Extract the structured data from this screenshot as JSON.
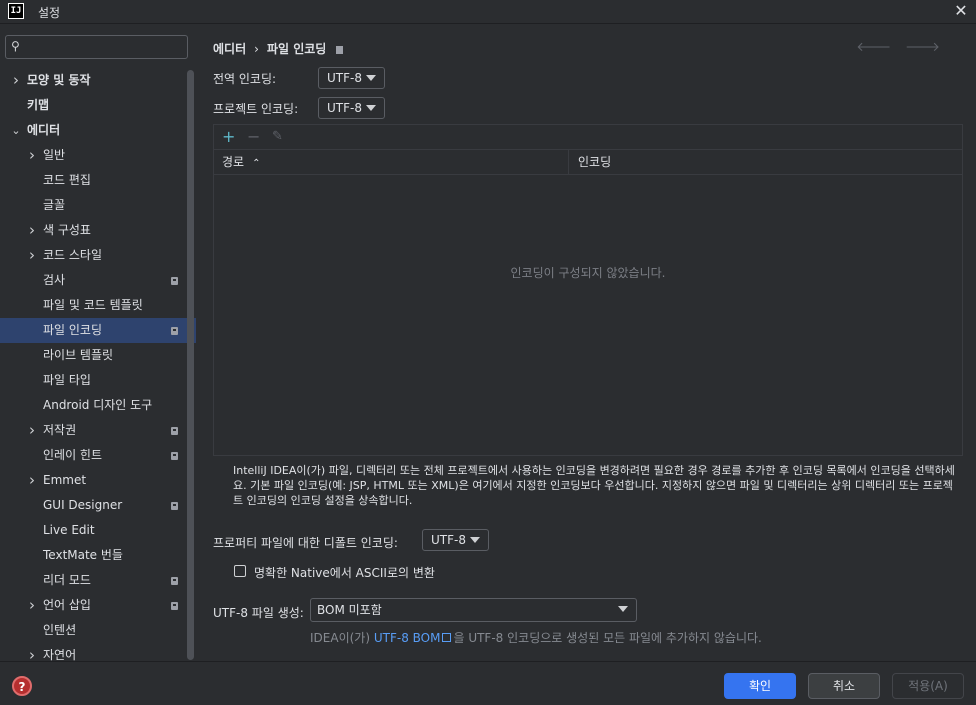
{
  "window": {
    "title": "설정",
    "logo": "IJ"
  },
  "search": {
    "placeholder": "",
    "value": ""
  },
  "sidebar": {
    "items": [
      {
        "label": "모양 및 동작",
        "level": 0,
        "expandable": true,
        "expanded": false,
        "bold": true
      },
      {
        "label": "키맵",
        "level": 0,
        "expandable": false,
        "bold": true
      },
      {
        "label": "에디터",
        "level": 0,
        "expandable": true,
        "expanded": true,
        "bold": true
      },
      {
        "label": "일반",
        "level": 1,
        "expandable": true,
        "expanded": false
      },
      {
        "label": "코드 편집",
        "level": 1
      },
      {
        "label": "글꼴",
        "level": 1
      },
      {
        "label": "색 구성표",
        "level": 1,
        "expandable": true,
        "expanded": false
      },
      {
        "label": "코드 스타일",
        "level": 1,
        "expandable": true,
        "expanded": false
      },
      {
        "label": "검사",
        "level": 1,
        "badge": true
      },
      {
        "label": "파일 및 코드 템플릿",
        "level": 1
      },
      {
        "label": "파일 인코딩",
        "level": 1,
        "badge": true,
        "selected": true
      },
      {
        "label": "라이브 템플릿",
        "level": 1
      },
      {
        "label": "파일 타입",
        "level": 1
      },
      {
        "label": "Android 디자인 도구",
        "level": 1
      },
      {
        "label": "저작권",
        "level": 1,
        "expandable": true,
        "expanded": false,
        "badge": true
      },
      {
        "label": "인레이 힌트",
        "level": 1,
        "badge": true
      },
      {
        "label": "Emmet",
        "level": 1,
        "expandable": true,
        "expanded": false
      },
      {
        "label": "GUI Designer",
        "level": 1,
        "badge": true
      },
      {
        "label": "Live Edit",
        "level": 1
      },
      {
        "label": "TextMate 번들",
        "level": 1
      },
      {
        "label": "리더 모드",
        "level": 1,
        "badge": true
      },
      {
        "label": "언어 삽입",
        "level": 1,
        "expandable": true,
        "expanded": false,
        "badge": true
      },
      {
        "label": "인텐션",
        "level": 1
      },
      {
        "label": "자연어",
        "level": 1,
        "expandable": true,
        "expanded": false
      }
    ]
  },
  "breadcrumb": {
    "parent": "에디터",
    "separator": "›",
    "current": "파일 인코딩"
  },
  "encoding": {
    "global_label": "전역 인코딩:",
    "global_value": "UTF-8",
    "project_label": "프로젝트 인코딩:",
    "project_value": "UTF-8"
  },
  "table": {
    "add": "+",
    "remove": "−",
    "edit": "✎",
    "col_path": "경로",
    "col_encoding": "인코딩",
    "empty_text": "인코딩이 구성되지 않았습니다."
  },
  "help_text": "IntelliJ IDEA이(가) 파일, 디렉터리 또는 전체 프로젝트에서 사용하는 인코딩을 변경하려면 필요한 경우 경로를 추가한 후 인코딩 목록에서 인코딩을 선택하세요. 기본 파일 인코딩(예: JSP, HTML 또는 XML)은 여기에서 지정한 인코딩보다 우선합니다. 지정하지 않으면 파일 및 디렉터리는 상위 디렉터리 또는 프로젝트 인코딩의 인코딩 설정을 상속합니다.",
  "properties": {
    "label": "프로퍼티 파일에 대한 디폴트 인코딩:",
    "value": "UTF-8"
  },
  "native_ascii": {
    "label": "명확한 Native에서 ASCII로의 변환",
    "checked": false
  },
  "bom": {
    "label": "UTF-8 파일 생성:",
    "value": "BOM 미포함",
    "note_prefix": "IDEA이(가) ",
    "note_link": "UTF-8 BOM",
    "note_suffix": "을 UTF-8 인코딩으로 생성된 모든 파일에 추가하지 않습니다."
  },
  "footer": {
    "help": "?",
    "ok": "확인",
    "cancel": "취소",
    "apply": "적용(A)"
  },
  "colors": {
    "accent": "#3574f0",
    "selection": "#2e436e",
    "link": "#589df6",
    "background": "#2b2d30"
  }
}
